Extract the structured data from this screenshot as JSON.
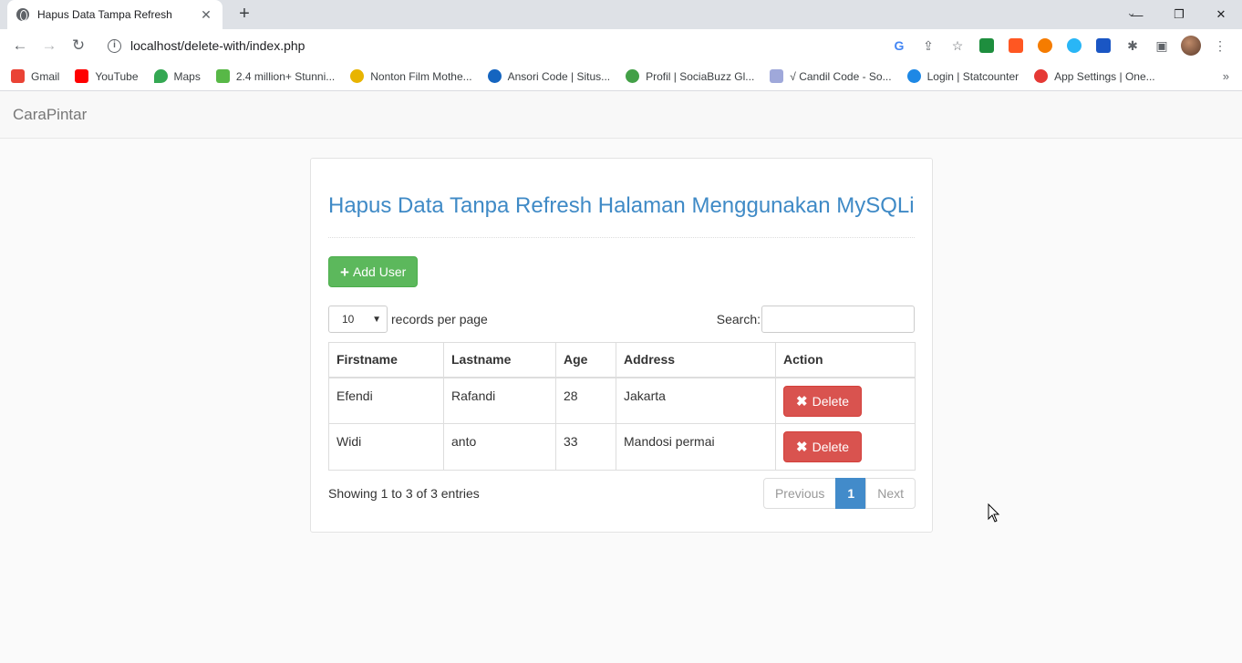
{
  "browser": {
    "tab_title": "Hapus Data Tampa Refresh",
    "url": "localhost/delete-with/index.php",
    "bookmarks": [
      {
        "label": "Gmail",
        "color": "#ea4335"
      },
      {
        "label": "YouTube",
        "color": "#ff0000"
      },
      {
        "label": "Maps",
        "color": "#34a853"
      },
      {
        "label": "2.4 million+ Stunni...",
        "color": "#58b847"
      },
      {
        "label": "Nonton Film Mothe...",
        "color": "#e8b400"
      },
      {
        "label": "Ansori Code | Situs...",
        "color": "#1565c0"
      },
      {
        "label": "Profil | SociaBuzz Gl...",
        "color": "#43a047"
      },
      {
        "label": "√ Candil Code - So...",
        "color": "#9fa8da"
      },
      {
        "label": "Login | Statcounter",
        "color": "#1e88e5"
      },
      {
        "label": "App Settings | One...",
        "color": "#e53935"
      }
    ]
  },
  "navbar": {
    "brand": "CaraPintar"
  },
  "main": {
    "title": "Hapus Data Tanpa Refresh Halaman Menggunakan MySQLi",
    "add_button": "Add User",
    "length_value": "10",
    "length_label": "records per page",
    "search_label": "Search:",
    "search_value": "",
    "table": {
      "headers": [
        "Firstname",
        "Lastname",
        "Age",
        "Address",
        "Action"
      ],
      "rows": [
        {
          "firstname": "Efendi",
          "lastname": "Rafandi",
          "age": "28",
          "address": "Jakarta",
          "action": "Delete"
        },
        {
          "firstname": "Widi",
          "lastname": "anto",
          "age": "33",
          "address": "Mandosi permai",
          "action": "Delete"
        }
      ]
    },
    "info": "Showing 1 to 3 of 3 entries",
    "pagination": {
      "previous": "Previous",
      "current": "1",
      "next": "Next"
    }
  },
  "colors": {
    "title": "#3f8ac6",
    "success": "#5cb85c",
    "danger": "#d9534f",
    "primary": "#428bca"
  }
}
